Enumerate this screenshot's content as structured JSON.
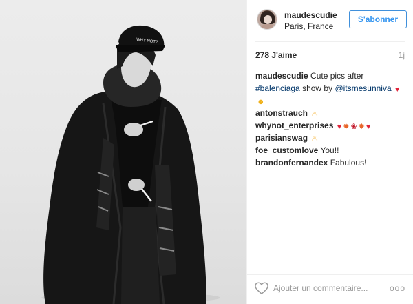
{
  "post": {
    "username": "maudescudie",
    "location": "Paris, France",
    "follow_label": "S'abonner",
    "likes": "278 J'aime",
    "time": "1j",
    "photo_overlay": {
      "cap_text": "WHY NOT?"
    }
  },
  "caption": {
    "user": "maudescudie",
    "text_before": "Cute pics after ",
    "hashtag": "#balenciaga",
    "text_middle": " show by ",
    "mention": "@itsmesunniva",
    "emojis": [
      "red-heart",
      "face-blowing-kiss"
    ]
  },
  "comments": [
    {
      "user": "antonstrauch",
      "text": "",
      "emojis": [
        "fire"
      ]
    },
    {
      "user": "whynot_enterprises",
      "text": "",
      "emojis": [
        "red-heart",
        "collision",
        "rose",
        "collision",
        "red-heart"
      ]
    },
    {
      "user": "parisianswag",
      "text": "",
      "emojis": [
        "fire"
      ]
    },
    {
      "user": "foe_customlove",
      "text": "You!!",
      "emojis": []
    },
    {
      "user": "brandonfernandex",
      "text": "Fabulous!",
      "emojis": []
    }
  ],
  "footer": {
    "comment_placeholder": "Ajouter un commentaire...",
    "more_label": "ooo"
  },
  "icons": {
    "like": "heart-outline-icon",
    "more": "more-options-icon"
  },
  "colors": {
    "accent": "#3897f0",
    "link": "#003569",
    "muted": "#999999"
  }
}
